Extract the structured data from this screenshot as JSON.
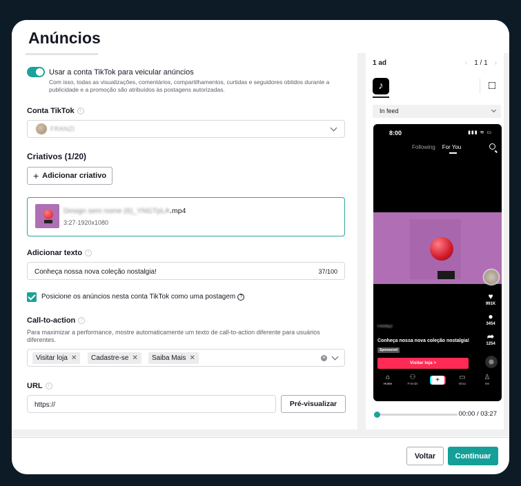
{
  "modal": {
    "title": "Anúncios"
  },
  "toggle": {
    "on": true,
    "title": "Usar a conta TikTok para veicular anúncios",
    "description": "Com isso, todas as visualizações, comentários, compartilhamentos, curtidas e seguidores obtidos durante a publicidade e a promoção são atribuídos às postagens autorizadas."
  },
  "account": {
    "label": "Conta TikTok",
    "name": "FRANZI"
  },
  "creatives": {
    "heading": "Criativos (1/20)",
    "add_label": "Adicionar criativo",
    "file_name_blurred": "Design sem nome (6)_YNGTpLA",
    "file_ext": ".mp4",
    "file_meta": "3:27·1920x1080"
  },
  "ad_text": {
    "label": "Adicionar texto",
    "value": "Conheça nossa nova coleção nostalgia!",
    "count": "37/100"
  },
  "post_checkbox": {
    "checked": true,
    "label": "Posicione os anúncios nesta conta TikTok como uma postagem",
    "help": "?"
  },
  "cta": {
    "label": "Call-to-action",
    "description": "Para maximizar a performance, mostre automaticamente um texto de call-to-action diferente para usuários diferentes.",
    "tags": [
      "Visitar loja",
      "Cadastre-se",
      "Saiba Mais"
    ]
  },
  "url": {
    "label": "URL",
    "value": "https://",
    "preview_label": "Pré-visualizar"
  },
  "preview": {
    "ad_count": "1 ad",
    "page": "1 / 1",
    "placement": "In feed",
    "phone": {
      "time": "8:00",
      "status_icons": "▮▮▮ ≋ ▭",
      "tab_following": "Following",
      "tab_foryou": "For You",
      "likes": "991K",
      "comments": "3454",
      "shares": "1254",
      "username": "FRANZI",
      "caption": "Conheça nossa nova coleção nostalgia!",
      "sponsored": "Sponsored",
      "cta_button": "Visitar loja >",
      "nav": {
        "home": "Home",
        "friends": "Friends",
        "inbox": "Inbox",
        "me": "Me"
      }
    },
    "progress_fraction": 0,
    "time": "00:00 / 03:27"
  },
  "footer": {
    "back": "Voltar",
    "continue": "Continuar"
  },
  "colors": {
    "accent": "#1aa39a",
    "tiktok_red": "#fe2c55",
    "background": "#0d1b26"
  }
}
